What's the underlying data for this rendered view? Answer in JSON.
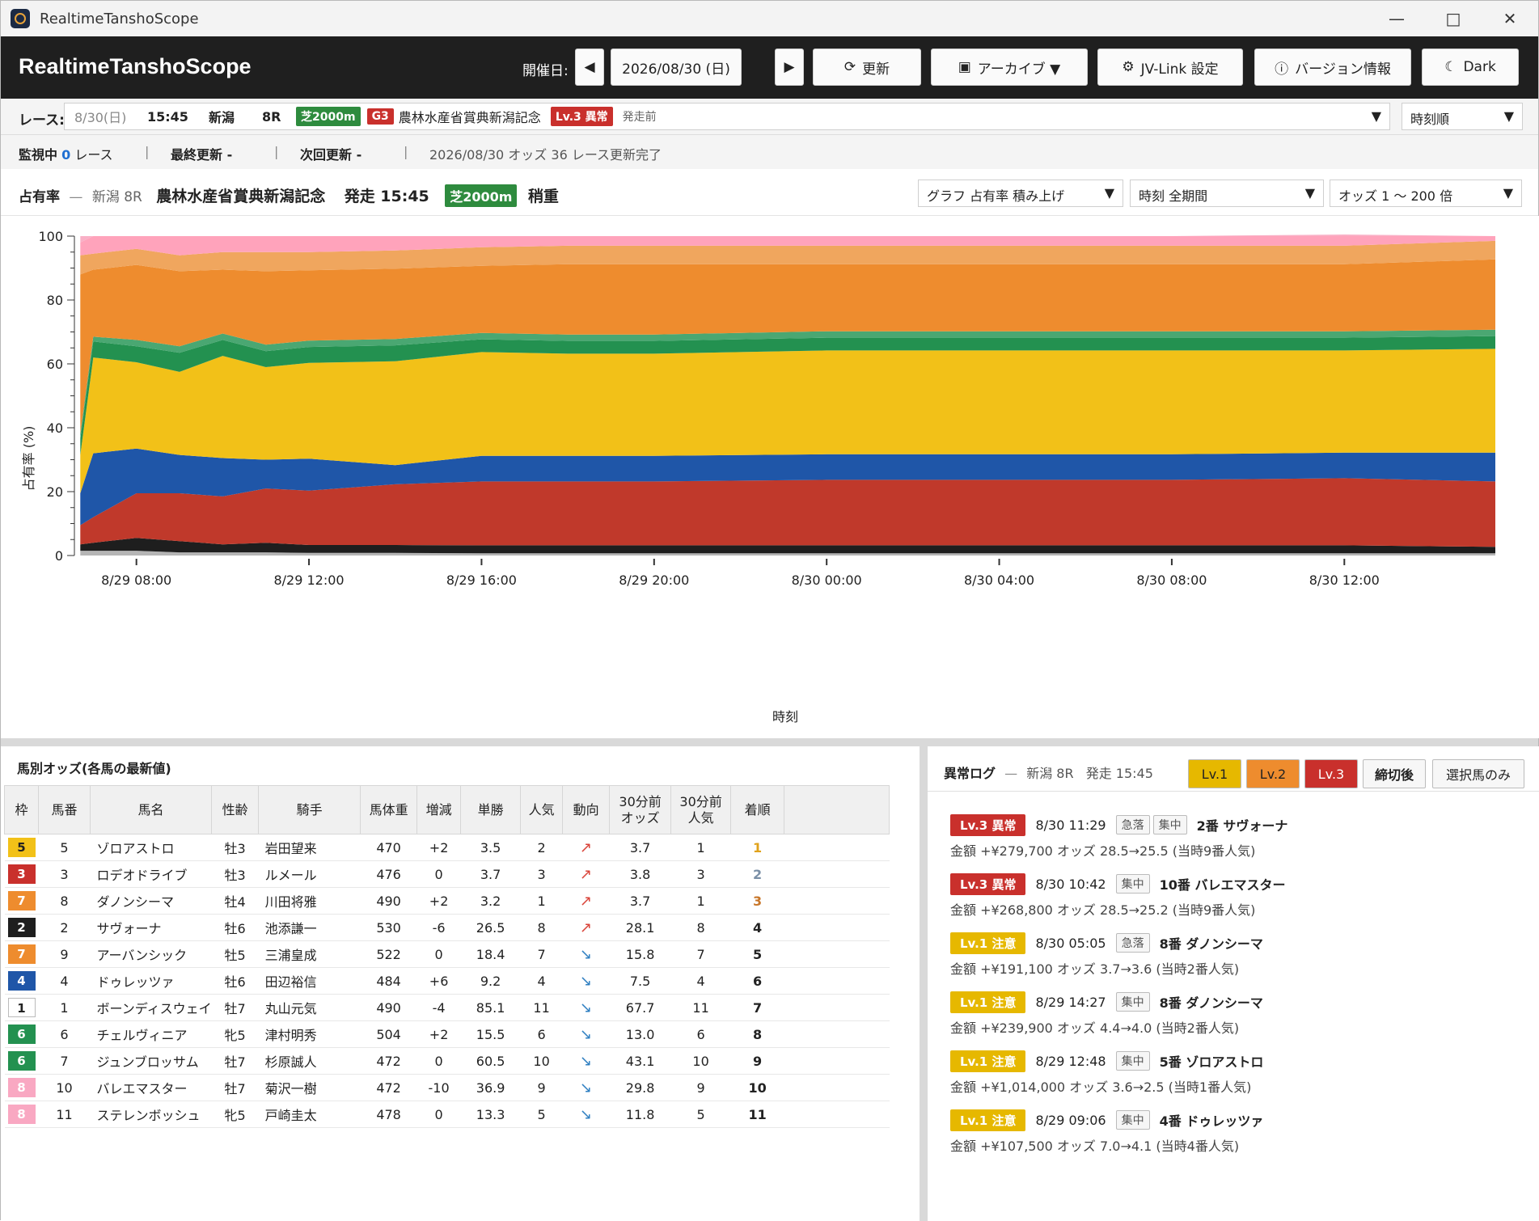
{
  "window": {
    "title": "RealtimeTanshoScope"
  },
  "header": {
    "app_name": "RealtimeTanshoScope",
    "date_label": "開催日:",
    "date_value": "2026/08/30 (日)",
    "refresh_label": "更新",
    "archive_label": "アーカイブ ▼",
    "jvlink_label": "JV-Link 設定",
    "version_label": "バージョン情報",
    "theme_label": "Dark"
  },
  "race": {
    "label": "レース:",
    "date": "8/30(日)",
    "time": "15:45",
    "venue": "新潟",
    "race_no": "8R",
    "course": "芝2000m",
    "grade": "G3",
    "name": "農林水産省賞典新潟記念",
    "alert": "Lv.3 異常",
    "state": "発走前",
    "sort": "時刻順"
  },
  "status": {
    "watching_label": "監視中",
    "watching_count": "0",
    "watching_unit": "レース",
    "last_update": "最終更新 -",
    "next_update": "次回更新 -",
    "message": "2026/08/30 オッズ 36 レース更新完了"
  },
  "chart_head": {
    "title": "占有率",
    "dash": "—",
    "venue_race": "新潟 8R",
    "race_name": "農林水産省賞典新潟記念",
    "start": "発走 15:45",
    "course": "芝2000m",
    "going": "稍重",
    "graph_select": "グラフ 占有率 積み上げ",
    "time_select": "時刻 全期間",
    "odds_select": "オッズ 1 〜 200 倍"
  },
  "chart_data": {
    "type": "area",
    "stacked": true,
    "ylabel": "占有率 (%)",
    "xlabel": "時刻",
    "ylim": [
      0,
      100
    ],
    "y_ticks": [
      0,
      20,
      40,
      60,
      80,
      100
    ],
    "x_tick_labels": [
      "8/29 08:00",
      "8/29 12:00",
      "8/29 16:00",
      "8/29 20:00",
      "8/30 00:00",
      "8/30 04:00",
      "8/30 08:00",
      "8/30 12:00"
    ],
    "x_tick_hours": [
      8,
      12,
      16,
      20,
      24,
      28,
      32,
      36
    ],
    "x_range_hours": [
      6.6,
      39.5
    ],
    "times_hours": [
      6.7,
      7.0,
      8.0,
      9.0,
      10.0,
      11.0,
      12.0,
      14.0,
      16.0,
      18.0,
      20.0,
      24.0,
      28.0,
      32.0,
      36.0,
      39.5
    ],
    "series": [
      {
        "color": "#b5b5b5",
        "values": [
          1.5,
          1.5,
          1.5,
          1.0,
          1.0,
          1.0,
          0.8,
          0.8,
          0.7,
          0.7,
          0.7,
          0.7,
          0.7,
          0.7,
          0.7,
          0.7
        ]
      },
      {
        "color": "#1e1e1e",
        "values": [
          2.0,
          2.5,
          4.0,
          3.5,
          2.5,
          3.0,
          2.5,
          2.5,
          2.5,
          2.5,
          2.5,
          2.5,
          2.5,
          2.5,
          2.5,
          2.0
        ]
      },
      {
        "color": "#c0392b",
        "values": [
          6.0,
          8.0,
          14.0,
          15.0,
          15.0,
          17.0,
          17.0,
          19.0,
          20.0,
          20.0,
          20.0,
          20.5,
          20.5,
          20.5,
          21.0,
          20.5
        ]
      },
      {
        "color": "#1f56a8",
        "values": [
          10.0,
          20.0,
          14.0,
          12.0,
          12.0,
          9.0,
          10.0,
          6.0,
          8.0,
          8.0,
          8.0,
          8.0,
          8.0,
          8.0,
          8.0,
          9.0
        ]
      },
      {
        "color": "#f2c118",
        "values": [
          12.0,
          30.0,
          27.0,
          26.0,
          32.0,
          29.0,
          30.0,
          32.5,
          32.5,
          32.0,
          32.0,
          32.5,
          32.5,
          32.5,
          32.0,
          32.5
        ]
      },
      {
        "color": "#239150",
        "values": [
          5.0,
          5.0,
          5.0,
          6.0,
          5.0,
          5.0,
          5.0,
          5.0,
          4.0,
          4.0,
          4.0,
          4.0,
          4.0,
          4.0,
          4.0,
          4.0
        ]
      },
      {
        "color": "#4aa772",
        "values": [
          1.5,
          1.5,
          2.0,
          2.0,
          2.0,
          2.0,
          2.0,
          2.0,
          2.0,
          2.0,
          2.0,
          2.0,
          2.0,
          2.0,
          2.0,
          2.0
        ]
      },
      {
        "color": "#ee8c2e",
        "values": [
          50.0,
          21.0,
          23.5,
          23.5,
          20.0,
          23.0,
          22.0,
          22.0,
          21.0,
          22.0,
          22.0,
          21.0,
          21.0,
          21.0,
          21.0,
          22.0
        ]
      },
      {
        "color": "#f0a65e",
        "values": [
          6.0,
          5.0,
          5.0,
          5.0,
          5.5,
          6.0,
          5.7,
          5.7,
          5.8,
          5.8,
          5.8,
          5.8,
          5.8,
          5.8,
          5.8,
          5.8
        ]
      },
      {
        "color": "#ffa3bb",
        "values": [
          4.0,
          5.5,
          4.0,
          6.0,
          5.0,
          5.0,
          5.0,
          4.5,
          3.5,
          3.0,
          3.0,
          3.0,
          3.0,
          3.0,
          3.5,
          1.5
        ]
      },
      {
        "color": "#f9b0c6",
        "values": [
          2.0,
          2.0,
          2.0,
          2.0,
          2.0,
          2.0,
          2.0,
          2.0,
          2.0,
          2.0,
          2.0,
          2.0,
          2.0,
          2.0,
          2.0,
          2.0
        ]
      }
    ]
  },
  "odds_panel": {
    "title": "馬別オッズ(各馬の最新値)",
    "headers": [
      "枠",
      "馬番",
      "馬名",
      "性齢",
      "騎手",
      "馬体重",
      "増減",
      "単勝",
      "人気",
      "動向",
      "30分前\nオッズ",
      "30分前\n人気",
      "着順"
    ],
    "waku_colors": {
      "1": "#ffffff",
      "2": "#1e1e1e",
      "3": "#c9302c",
      "4": "#1f56a8",
      "5": "#f2c118",
      "6": "#239150",
      "7": "#ee8c2e",
      "8": "#f9a8c2"
    },
    "rows": [
      {
        "waku": "5",
        "num": "5",
        "name": "ゾロアストロ",
        "sex": "牡3",
        "jockey": "岩田望来",
        "weight": "470",
        "diff": "+2",
        "odds": "3.5",
        "pop": "2",
        "trend": "↗",
        "trend_dir": "up",
        "odds30": "3.7",
        "pop30": "1",
        "rank": "1",
        "rank_color": "#e0a21b"
      },
      {
        "waku": "3",
        "num": "3",
        "name": "ロデオドライブ",
        "sex": "牡3",
        "jockey": "ルメール",
        "weight": "476",
        "diff": "0",
        "odds": "3.7",
        "pop": "3",
        "trend": "↗",
        "trend_dir": "up",
        "odds30": "3.8",
        "pop30": "3",
        "rank": "2",
        "rank_color": "#7a8fa6"
      },
      {
        "waku": "7",
        "num": "8",
        "name": "ダノンシーマ",
        "sex": "牡4",
        "jockey": "川田将雅",
        "weight": "490",
        "diff": "+2",
        "odds": "3.2",
        "pop": "1",
        "trend": "↗",
        "trend_dir": "up",
        "odds30": "3.7",
        "pop30": "1",
        "rank": "3",
        "rank_color": "#c8772a"
      },
      {
        "waku": "2",
        "num": "2",
        "name": "サヴォーナ",
        "sex": "牡6",
        "jockey": "池添謙一",
        "weight": "530",
        "diff": "-6",
        "odds": "26.5",
        "pop": "8",
        "trend": "↗",
        "trend_dir": "up",
        "odds30": "28.1",
        "pop30": "8",
        "rank": "4",
        "rank_color": "#222222"
      },
      {
        "waku": "7",
        "num": "9",
        "name": "アーバンシック",
        "sex": "牡5",
        "jockey": "三浦皇成",
        "weight": "522",
        "diff": "0",
        "odds": "18.4",
        "pop": "7",
        "trend": "↘",
        "trend_dir": "down",
        "odds30": "15.8",
        "pop30": "7",
        "rank": "5",
        "rank_color": "#222222"
      },
      {
        "waku": "4",
        "num": "4",
        "name": "ドゥレッツァ",
        "sex": "牡6",
        "jockey": "田辺裕信",
        "weight": "484",
        "diff": "+6",
        "odds": "9.2",
        "pop": "4",
        "trend": "↘",
        "trend_dir": "down",
        "odds30": "7.5",
        "pop30": "4",
        "rank": "6",
        "rank_color": "#222222"
      },
      {
        "waku": "1",
        "num": "1",
        "name": "ボーンディスウェイ",
        "sex": "牡7",
        "jockey": "丸山元気",
        "weight": "490",
        "diff": "-4",
        "odds": "85.1",
        "pop": "11",
        "trend": "↘",
        "trend_dir": "down",
        "odds30": "67.7",
        "pop30": "11",
        "rank": "7",
        "rank_color": "#222222"
      },
      {
        "waku": "6",
        "num": "6",
        "name": "チェルヴィニア",
        "sex": "牝5",
        "jockey": "津村明秀",
        "weight": "504",
        "diff": "+2",
        "odds": "15.5",
        "pop": "6",
        "trend": "↘",
        "trend_dir": "down",
        "odds30": "13.0",
        "pop30": "6",
        "rank": "8",
        "rank_color": "#222222"
      },
      {
        "waku": "6",
        "num": "7",
        "name": "ジュンブロッサム",
        "sex": "牡7",
        "jockey": "杉原誠人",
        "weight": "472",
        "diff": "0",
        "odds": "60.5",
        "pop": "10",
        "trend": "↘",
        "trend_dir": "down",
        "odds30": "43.1",
        "pop30": "10",
        "rank": "9",
        "rank_color": "#222222"
      },
      {
        "waku": "8",
        "num": "10",
        "name": "バレエマスター",
        "sex": "牡7",
        "jockey": "菊沢一樹",
        "weight": "472",
        "diff": "-10",
        "odds": "36.9",
        "pop": "9",
        "trend": "↘",
        "trend_dir": "down",
        "odds30": "29.8",
        "pop30": "9",
        "rank": "10",
        "rank_color": "#222222"
      },
      {
        "waku": "8",
        "num": "11",
        "name": "ステレンボッシュ",
        "sex": "牝5",
        "jockey": "戸崎圭太",
        "weight": "478",
        "diff": "0",
        "odds": "13.3",
        "pop": "5",
        "trend": "↘",
        "trend_dir": "down",
        "odds30": "11.8",
        "pop30": "5",
        "rank": "11",
        "rank_color": "#222222"
      }
    ]
  },
  "alert_panel": {
    "title": "異常ログ",
    "dash": "—",
    "race": "新潟 8R",
    "start": "発走 15:45",
    "buttons": {
      "lv1": "Lv.1",
      "lv2": "Lv.2",
      "lv3": "Lv.3",
      "after_close": "締切後",
      "selected_only": "選択馬のみ"
    },
    "button_colors": {
      "lv1": "#e6b800",
      "lv2": "#ee8c2e",
      "lv3": "#c9302c"
    },
    "items": [
      {
        "level": "Lv.3 異常",
        "level_color": "#c9302c",
        "time": "8/30 11:29",
        "chips": [
          "急落",
          "集中"
        ],
        "horse": "2番 サヴォーナ",
        "detail": "金額 +¥279,700  オッズ 28.5→25.5 (当時9番人気)"
      },
      {
        "level": "Lv.3 異常",
        "level_color": "#c9302c",
        "time": "8/30 10:42",
        "chips": [
          "集中"
        ],
        "horse": "10番 バレエマスター",
        "detail": "金額 +¥268,800  オッズ 28.5→25.2 (当時9番人気)"
      },
      {
        "level": "Lv.1 注意",
        "level_color": "#e6b800",
        "time": "8/30 05:05",
        "chips": [
          "急落"
        ],
        "horse": "8番 ダノンシーマ",
        "detail": "金額 +¥191,100  オッズ 3.7→3.6 (当時2番人気)"
      },
      {
        "level": "Lv.1 注意",
        "level_color": "#e6b800",
        "time": "8/29 14:27",
        "chips": [
          "集中"
        ],
        "horse": "8番 ダノンシーマ",
        "detail": "金額 +¥239,900  オッズ 4.4→4.0 (当時2番人気)"
      },
      {
        "level": "Lv.1 注意",
        "level_color": "#e6b800",
        "time": "8/29 12:48",
        "chips": [
          "集中"
        ],
        "horse": "5番 ゾロアストロ",
        "detail": "金額 +¥1,014,000  オッズ 3.6→2.5 (当時1番人気)"
      },
      {
        "level": "Lv.1 注意",
        "level_color": "#e6b800",
        "time": "8/29 09:06",
        "chips": [
          "集中"
        ],
        "horse": "4番 ドゥレッツァ",
        "detail": "金額 +¥107,500  オッズ 7.0→4.1 (当時4番人気)"
      }
    ]
  }
}
